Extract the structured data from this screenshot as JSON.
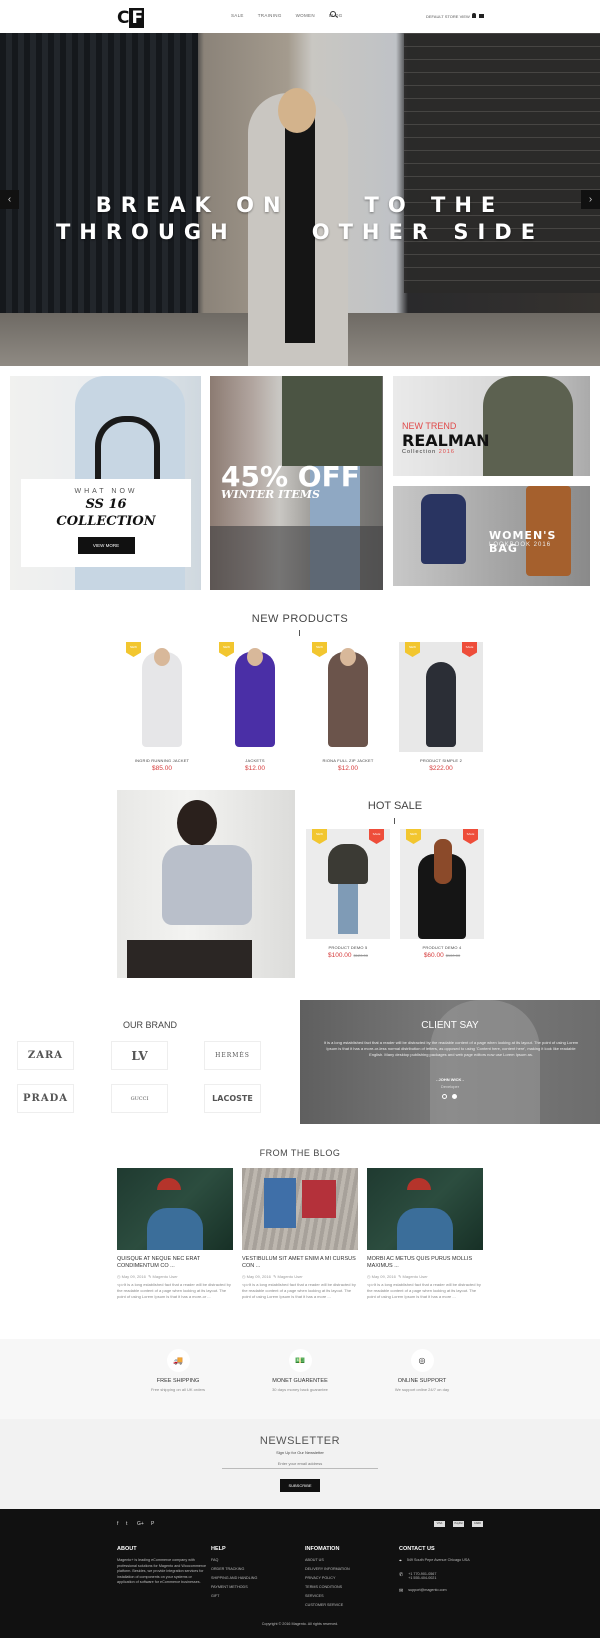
{
  "header": {
    "logo_text_c": "C",
    "logo_text_f": "F",
    "nav": [
      "SALE",
      "TRAINING",
      "WOMEN",
      "BLOG"
    ],
    "search_icon": "search-icon",
    "store_view": "DEFAULT STORE VIEW",
    "user_icon": "user-icon",
    "cart_icon": "cart-icon"
  },
  "hero": {
    "line1_left": "BREAK ON",
    "line1_right": "TO THE",
    "line2_left": "THROUGH",
    "line2_right": "OTHER SIDE",
    "prev": "‹",
    "next": "›"
  },
  "banners": {
    "collection": {
      "eyebrow": "WHAT NOW",
      "title_1": "SS 16",
      "title_2": "COLLECTION",
      "button": "VIEW MORE"
    },
    "offer": {
      "big": "45% OFF",
      "small": "WINTER ITEMS"
    },
    "realman": {
      "eyebrow": "NEW TREND",
      "title": "REALMAN",
      "sub": "Collection",
      "year": "2016"
    },
    "womens_bag": {
      "title": "WOMEN'S BAG",
      "sub": "LOOKBOOK 2016"
    }
  },
  "new_products": {
    "title": "NEW PRODUCTS",
    "items": [
      {
        "name": "INGRID RUNNING JACKET",
        "price": "$85.00",
        "badge_new": "NEW",
        "color": "#e6e6e8"
      },
      {
        "name": "JACKETS",
        "price": "$12.00",
        "badge_new": "NEW",
        "color": "#4a2fa6"
      },
      {
        "name": "RIONA FULL ZIP JACKET",
        "price": "$12.00",
        "badge_new": "NEW",
        "color": "#6b544b"
      },
      {
        "name": "PRODUCT SIMPLE 2",
        "price": "$222.00",
        "badge_new": "NEW",
        "badge_sale": "SALE",
        "color": "#2b2e36"
      }
    ]
  },
  "hot_sale": {
    "title": "HOT SALE",
    "items": [
      {
        "name": "PRODUCT DEMO 5",
        "price": "$100.00",
        "old_price": "$120.00",
        "badge_new": "NEW",
        "badge_sale": "SALE"
      },
      {
        "name": "PRODUCT DEMO 4",
        "price": "$60.00",
        "old_price": "$100.00",
        "badge_new": "NEW",
        "badge_sale": "SALE"
      }
    ]
  },
  "brands": {
    "title": "OUR BRAND",
    "items": [
      "ZARA",
      "LV",
      "HERMÈS",
      "PRADA",
      "GUCCI",
      "LACOSTE"
    ]
  },
  "client_say": {
    "title": "CLIENT SAY",
    "quote": "It is a long established fact that a reader will be distracted by the readable content of a page when looking at its layout. The point of using Lorem Ipsum is that it has a more-or-less normal distribution of letters, as opposed to using 'Content here, content here', making it look like readable English. Many desktop publishing packages and web page editors now use Lorem Ipsum as.",
    "author": "- JOHN WICK -",
    "role": "Developer"
  },
  "blog": {
    "title": "FROM THE BLOG",
    "posts": [
      {
        "title": "QUISQUE AT NEQUE NEC ERAT CONDIMENTUM CO ...",
        "date": "May 09, 2016",
        "author": "Magento User",
        "excerpt": "<p>It is a long established fact that a reader will be distracted by the readable content of a page when looking at its layout. The point of using Lorem Ipsum is that it has a more-or ..."
      },
      {
        "title": "VESTIBULUM SIT AMET ENIM A MI CURSUS CON ...",
        "date": "May 09, 2016",
        "author": "Magento User",
        "excerpt": "<p>It is a long established fact that a reader will be distracted by the readable content of a page when looking at its layout. The point of using Lorem Ipsum is that it has a more ..."
      },
      {
        "title": "MORBI AC METUS QUIS PURUS MOLLIS MAXIMUS ...",
        "date": "May 09, 2016",
        "author": "Magento User",
        "excerpt": "<p>It is a long established fact that a reader will be distracted by the readable content of a page when looking at its layout. The point of using Lorem Ipsum is that it has a more ..."
      }
    ]
  },
  "services": [
    {
      "icon": "truck-icon",
      "glyph": "🚚",
      "title": "FREE SHIPPING",
      "sub": "Free shipping on all UK orders"
    },
    {
      "icon": "money-icon",
      "glyph": "💵",
      "title": "MONET GUARENTEE",
      "sub": "30 days money back guarantee"
    },
    {
      "icon": "support-icon",
      "glyph": "◎",
      "title": "ONLINE SUPPORT",
      "sub": "We support online 24/7 on day"
    }
  ],
  "newsletter": {
    "title": "NEWSLETTER",
    "sub": "Sign Up for Our Newsletter",
    "placeholder": "Enter your email address",
    "button": "SUBSCRIBE"
  },
  "footer": {
    "social": [
      "f",
      "t",
      "G+",
      "P"
    ],
    "payments": [
      "VISA",
      "PayPal",
      "CARD"
    ],
    "about": {
      "title": "ABOUT",
      "text": "Magento+ is leading eCommerce company with professional solutions for Magento and Woocommerce platform. Besides, we provide integration services for installation of components on your systems or application of software for eCommerce businesses."
    },
    "help": {
      "title": "HELP",
      "links": [
        "FAQ",
        "ORDER TRACKING",
        "SHIPPING AND HANDLING",
        "PAYMENT METHODS",
        "GIFT"
      ]
    },
    "information": {
      "title": "INFOMATION",
      "links": [
        "ABOUT US",
        "DELIVERY INFORMATION",
        "PRIVACY POLICY",
        "TERMS CONDITIONS",
        "SERVICES",
        "CUSTOMER SERVICE"
      ]
    },
    "contact": {
      "title": "CONTACT US",
      "address": "549 South Pepe Avenue Chicago USA",
      "phone1": "+1 770-901-0567",
      "phone2": "+1 555-404-0021",
      "email": "support@magento.com"
    },
    "copyright": "Copyright © 2016 Magento. All rights reserved."
  }
}
